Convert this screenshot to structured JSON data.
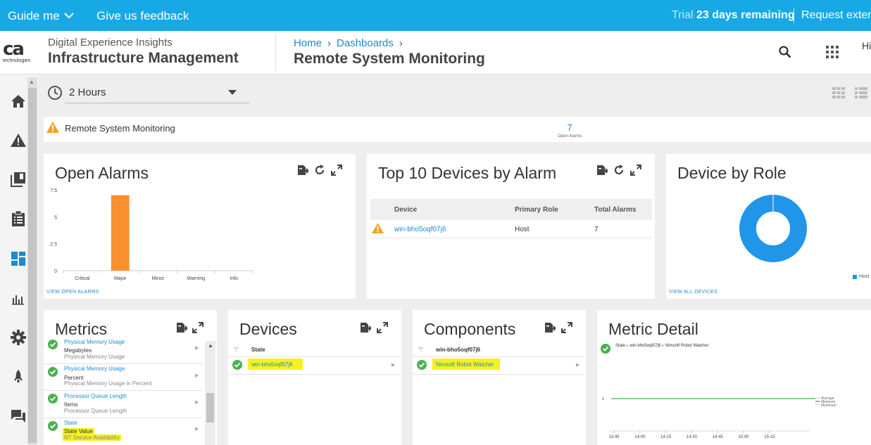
{
  "topbar": {
    "guide_label": "Guide me",
    "feedback_label": "Give us feedback",
    "trial_prefix": "Trial",
    "trial_days": "23 days remaining",
    "request_label": "Request extension"
  },
  "header": {
    "logo_text": "ca",
    "logo_sub": "technologies",
    "product_sub": "Digital Experience Insights",
    "product_main": "Infrastructure Management",
    "breadcrumb": [
      "Home",
      "Dashboards"
    ],
    "page_title": "Remote System Monitoring",
    "user_greeting": "Hi"
  },
  "filter": {
    "time_range": "2 Hours"
  },
  "summary": {
    "label": "Remote System Monitoring",
    "open_alarms_count": "7",
    "open_alarms_label": "Open Alarms"
  },
  "open_alarms": {
    "title": "Open Alarms",
    "link": "VIEW OPEN ALARMS"
  },
  "chart_data": {
    "type": "bar",
    "categories": [
      "Critical",
      "Major",
      "Minor",
      "Warning",
      "Info"
    ],
    "values": [
      0,
      7,
      0,
      0,
      0
    ],
    "ylim": [
      0,
      7.5
    ],
    "yticks": [
      "0",
      "2.5",
      "5",
      "7.5"
    ],
    "bar_color": "#f7912f",
    "title": "",
    "xlabel": "",
    "ylabel": "",
    "grid": false
  },
  "top_devices": {
    "title": "Top 10 Devices by Alarm",
    "columns": [
      "Device",
      "Primary Role",
      "Total Alarms"
    ],
    "rows": [
      {
        "device": "win-bho5oqf07j6",
        "role": "Host",
        "alarms": "7"
      }
    ]
  },
  "device_role": {
    "title": "Device by Role",
    "legend": "Host",
    "link": "VIEW ALL DEVICES",
    "donut_color": "#2196e8"
  },
  "metrics": {
    "title": "Metrics",
    "items": [
      {
        "title": "Physical Memory Usage",
        "unit": "Megabytes",
        "desc": "Physical Memory Usage"
      },
      {
        "title": "Physical Memory Usage",
        "unit": "Percent",
        "desc": "Physical Memory Usage in Percent"
      },
      {
        "title": "Processor Queue Length",
        "unit": "Items",
        "desc": "Processor Queue Length"
      },
      {
        "title": "State",
        "unit": "State Value",
        "desc": "NT Service Availability"
      }
    ]
  },
  "devices": {
    "title": "Devices",
    "column": "State",
    "row": "win-bho5oqf07j6"
  },
  "components": {
    "title": "Components",
    "column": "win-bho5oqf07j6",
    "row": "Nimsoft Robot Watcher"
  },
  "metric_detail": {
    "title": "Metric Detail",
    "breadcrumb": [
      "State",
      "win-bho5oqf07j6",
      "Nimsoft Robot Watcher"
    ],
    "y_tick": "1",
    "x_ticks": [
      "13:45",
      "14:00",
      "14:15",
      "14:30",
      "14:45",
      "15:00",
      "15:15"
    ],
    "legend": [
      "Average",
      "Minimum",
      "Maximum"
    ],
    "line_color": "#6abf69"
  },
  "colors": {
    "accent": "#16a9e6",
    "link": "#1a8ad4",
    "ok": "#4caf50",
    "warn": "#f7a21b",
    "highlight": "#f7f21c"
  }
}
